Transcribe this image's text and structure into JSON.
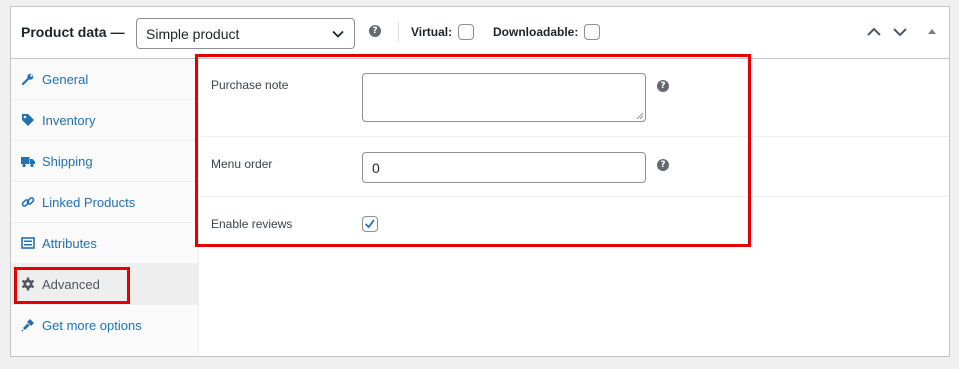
{
  "header": {
    "title": "Product data —",
    "product_type": {
      "selected": "Simple product",
      "icon": "chevron-down-icon"
    },
    "virtual_label": "Virtual:",
    "virtual_checked": false,
    "downloadable_label": "Downloadable:",
    "downloadable_checked": false
  },
  "sidebar": {
    "items": [
      {
        "label": "General",
        "icon": "wrench-icon",
        "active": false
      },
      {
        "label": "Inventory",
        "icon": "tag-icon",
        "active": false
      },
      {
        "label": "Shipping",
        "icon": "truck-icon",
        "active": false
      },
      {
        "label": "Linked Products",
        "icon": "link-icon",
        "active": false
      },
      {
        "label": "Attributes",
        "icon": "list-icon",
        "active": false
      },
      {
        "label": "Advanced",
        "icon": "gear-icon",
        "active": true
      },
      {
        "label": "Get more options",
        "icon": "plugin-icon",
        "active": false
      }
    ]
  },
  "advanced": {
    "purchase_note": {
      "label": "Purchase note",
      "value": ""
    },
    "menu_order": {
      "label": "Menu order",
      "value": "0"
    },
    "enable_reviews": {
      "label": "Enable reviews",
      "checked": true
    }
  },
  "colors": {
    "highlight": "#e50000",
    "link": "#2271b1",
    "help_icon": "#646970"
  }
}
